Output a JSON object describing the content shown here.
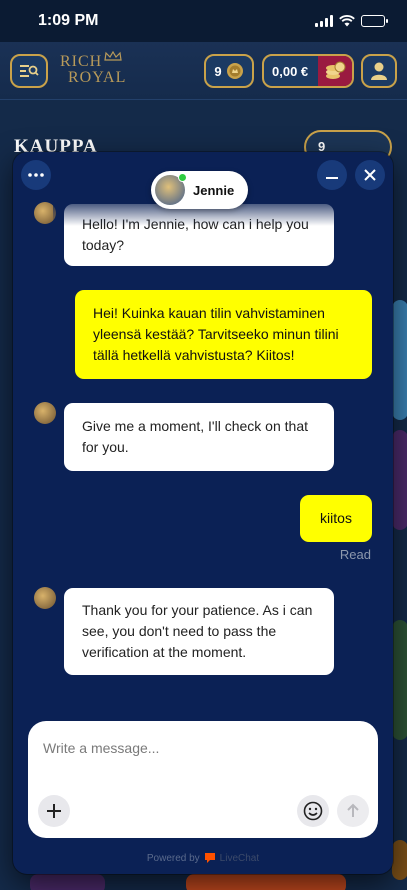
{
  "status_bar": {
    "time": "1:09 PM"
  },
  "header": {
    "logo_line1": "RICH",
    "logo_line2": "ROYAL",
    "coins_count": "9",
    "balance": "0,00 €"
  },
  "page": {
    "title": "KAUPPA",
    "pill_count": "9"
  },
  "chat": {
    "agent_name": "Jennie",
    "messages": [
      {
        "from": "agent",
        "text": "Hello! I'm Jennie, how can i help you today?"
      },
      {
        "from": "user",
        "text": "Hei! Kuinka kauan tilin vahvistaminen yleensä kestää? Tarvitseeko minun tilini tällä hetkellä vahvistusta? Kiitos!"
      },
      {
        "from": "agent",
        "text": "Give me a moment, I'll check on that for you."
      },
      {
        "from": "user",
        "text": "kiitos"
      },
      {
        "from": "agent",
        "text": "Thank you for your patience. As i can see, you don't need to pass the verification at the moment."
      }
    ],
    "read_status": "Read",
    "composer_placeholder": "Write a message...",
    "powered_by": "Powered by",
    "powered_brand": "LiveChat"
  },
  "colors": {
    "chat_bg": "#0b2155",
    "user_bubble": "#ffff00",
    "agent_bubble": "#ffffff",
    "gold_accent": "#c9a24a",
    "wallet_red": "#9a1a40"
  },
  "icons": [
    "menu-search-icon",
    "crown-icon",
    "coin-icon",
    "wallet-coins-icon",
    "user-icon",
    "more-dots-icon",
    "minimize-icon",
    "close-icon",
    "plus-icon",
    "emoji-icon",
    "send-arrow-icon",
    "livechat-logo-icon"
  ]
}
